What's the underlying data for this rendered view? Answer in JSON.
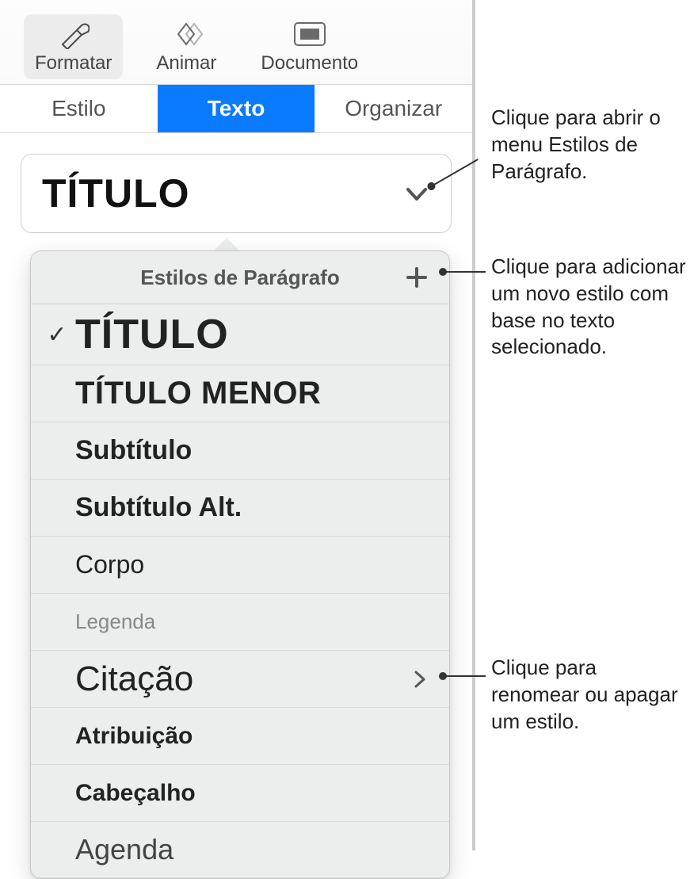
{
  "toolbar": {
    "format": "Formatar",
    "animate": "Animar",
    "document": "Documento"
  },
  "tabs": {
    "style": "Estilo",
    "text": "Texto",
    "organize": "Organizar"
  },
  "current_style": "TÍTULO",
  "popover": {
    "title": "Estilos de Parágrafo",
    "styles": [
      {
        "label": "TÍTULO",
        "class": "st-titulo",
        "checked": true,
        "has_submenu": false
      },
      {
        "label": "TÍTULO MENOR",
        "class": "st-titulo-menor",
        "checked": false,
        "has_submenu": false
      },
      {
        "label": "Subtítulo",
        "class": "st-subtitulo",
        "checked": false,
        "has_submenu": false
      },
      {
        "label": "Subtítulo Alt.",
        "class": "st-subtitulo-alt",
        "checked": false,
        "has_submenu": false
      },
      {
        "label": "Corpo",
        "class": "st-corpo",
        "checked": false,
        "has_submenu": false
      },
      {
        "label": "Legenda",
        "class": "st-legenda",
        "checked": false,
        "has_submenu": false
      },
      {
        "label": "Citação",
        "class": "st-citacao",
        "checked": false,
        "has_submenu": true
      },
      {
        "label": "Atribuição",
        "class": "st-atribuicao",
        "checked": false,
        "has_submenu": false
      },
      {
        "label": "Cabeçalho",
        "class": "st-cabecalho",
        "checked": false,
        "has_submenu": false
      },
      {
        "label": "Agenda",
        "class": "st-agenda",
        "checked": false,
        "has_submenu": false
      }
    ]
  },
  "callouts": {
    "open_menu": "Clique para abrir o menu Estilos de Parágrafo.",
    "add_style": "Clique para adicionar um novo estilo com base no texto selecionado.",
    "rename_delete": "Clique para renomear ou apagar um estilo."
  }
}
